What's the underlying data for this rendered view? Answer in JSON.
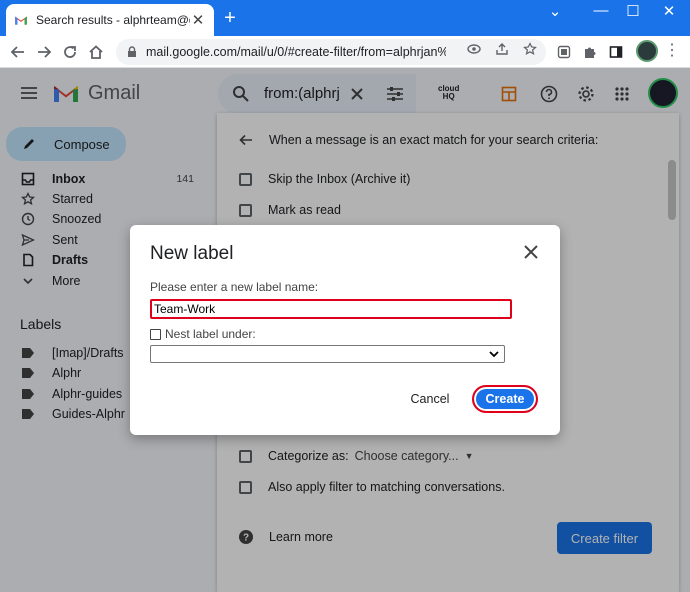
{
  "browser": {
    "tab_title": "Search results - alphrteam@gma",
    "url": "mail.google.com/mail/u/0/#create-filter/from=alphrjan%..."
  },
  "gmail": {
    "app_name": "Gmail",
    "search_text": "from:(alphrj",
    "cloudhq_line1": "cloud",
    "cloudhq_line2": "HQ"
  },
  "sidebar": {
    "compose_label": "Compose",
    "items": [
      {
        "label": "Inbox",
        "count": "141",
        "bold": true,
        "icon": "inbox-icon"
      },
      {
        "label": "Starred",
        "count": "",
        "bold": false,
        "icon": "star-icon"
      },
      {
        "label": "Snoozed",
        "count": "",
        "bold": false,
        "icon": "clock-icon"
      },
      {
        "label": "Sent",
        "count": "",
        "bold": false,
        "icon": "send-icon"
      },
      {
        "label": "Drafts",
        "count": "",
        "bold": true,
        "icon": "draft-icon"
      },
      {
        "label": "More",
        "count": "",
        "bold": false,
        "icon": "chevron-down-icon"
      }
    ],
    "labels_heading": "Labels",
    "labels": [
      "[Imap]/Drafts",
      "Alphr",
      "Alphr-guides",
      "Guides-Alphr"
    ]
  },
  "filter_panel": {
    "header": "When a message is an exact match for your search criteria:",
    "options_top": [
      "Skip the Inbox (Archive it)",
      "Mark as read"
    ],
    "categorize_label": "Categorize as:",
    "categorize_value": "Choose category...",
    "apply_label": "Also apply filter to matching conversations.",
    "learn_more": "Learn more",
    "create_filter": "Create filter"
  },
  "dialog": {
    "title": "New label",
    "prompt": "Please enter a new label name:",
    "input_value": "Team-Work",
    "nest_label": "Nest label under:",
    "cancel": "Cancel",
    "create": "Create"
  },
  "colors": {
    "accent": "#1a73e8",
    "highlight": "#e0001a",
    "compose_bg": "#c2e7ff"
  }
}
